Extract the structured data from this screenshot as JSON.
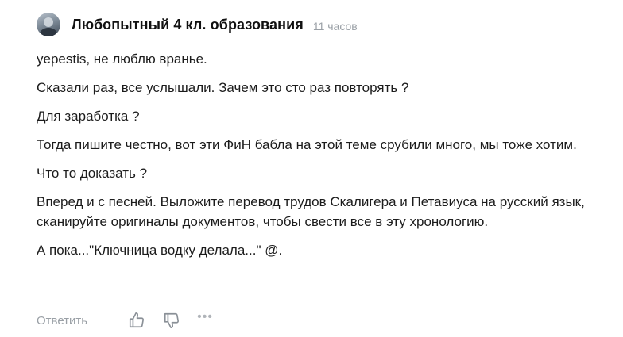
{
  "comment": {
    "author": "Любопытный 4 кл. образования",
    "time": "11 часов",
    "paragraphs": [
      "yepestis, не люблю вранье.",
      "Сказали раз, все услышали. Зачем это сто раз повторять ?",
      "Для заработка ?",
      "Тогда пишите честно, вот эти ФиН бабла на этой теме срубили много, мы тоже хотим.",
      "Что то доказать ?",
      "Вперед и с песней. Выложите перевод трудов Скалигера и Петавиуса на русский язык, сканируйте оригиналы документов, чтобы свести все в эту хронологию.",
      "А пока...\"Ключница водку делала...\" @."
    ]
  },
  "actions": {
    "reply_label": "Ответить",
    "like_icon": "thumbs-up-icon",
    "dislike_icon": "thumbs-down-icon",
    "more_label": "•••"
  }
}
